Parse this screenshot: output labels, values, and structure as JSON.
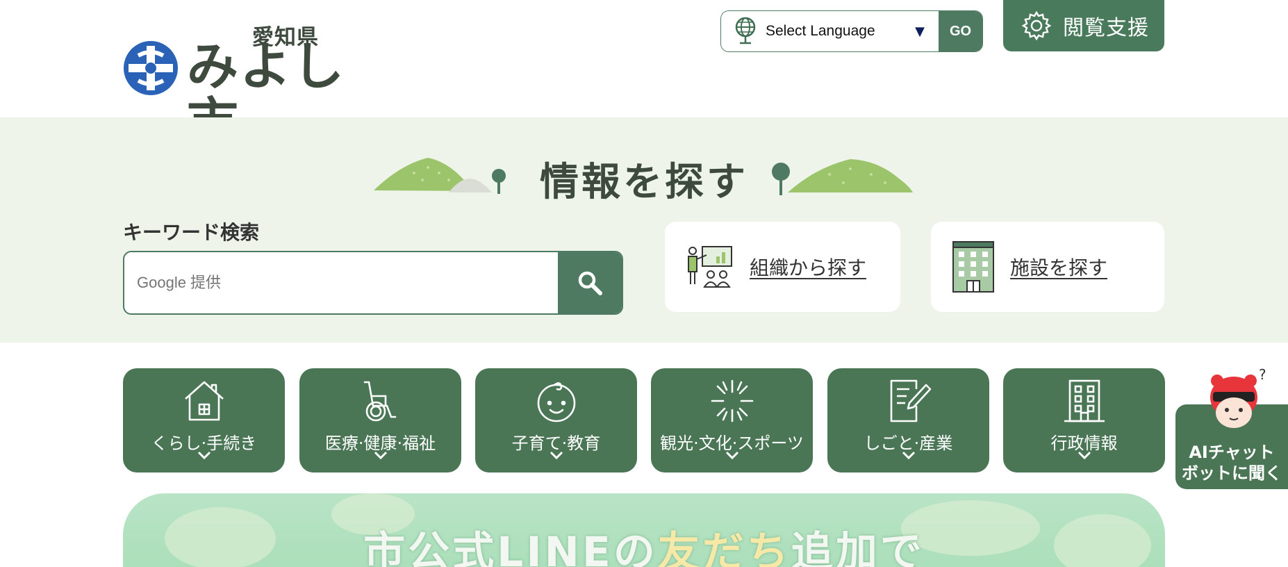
{
  "header": {
    "prefecture": "愛知県",
    "city": "みよし市",
    "language": {
      "selected": "Select Language",
      "go_label": "GO"
    },
    "assist_label": "閲覧支援"
  },
  "search_band": {
    "title": "情報を探す",
    "keyword_label": "キーワード検索",
    "search_placeholder": "Google 提供",
    "org_label": "組織から探す",
    "facility_label": "施設を探す"
  },
  "categories": [
    {
      "label": "くらし·手続き",
      "icon": "house-icon"
    },
    {
      "label": "医療·健康·福祉",
      "icon": "wheelchair-icon"
    },
    {
      "label": "子育て·教育",
      "icon": "baby-face-icon"
    },
    {
      "label": "観光·文化·スポーツ",
      "icon": "firework-icon"
    },
    {
      "label": "しごと·産業",
      "icon": "document-pen-icon"
    },
    {
      "label": "行政情報",
      "icon": "building-icon"
    }
  ],
  "chatbot": {
    "line1": "AIチャット",
    "line2": "ボットに聞く"
  },
  "banner": {
    "text_prefix": "市公式LINEの",
    "text_highlight": "友だち",
    "text_suffix": "追加で"
  },
  "colors": {
    "brand_green": "#4a7656",
    "band_bg": "#eef4ea",
    "logo_blue": "#2a62b8"
  }
}
